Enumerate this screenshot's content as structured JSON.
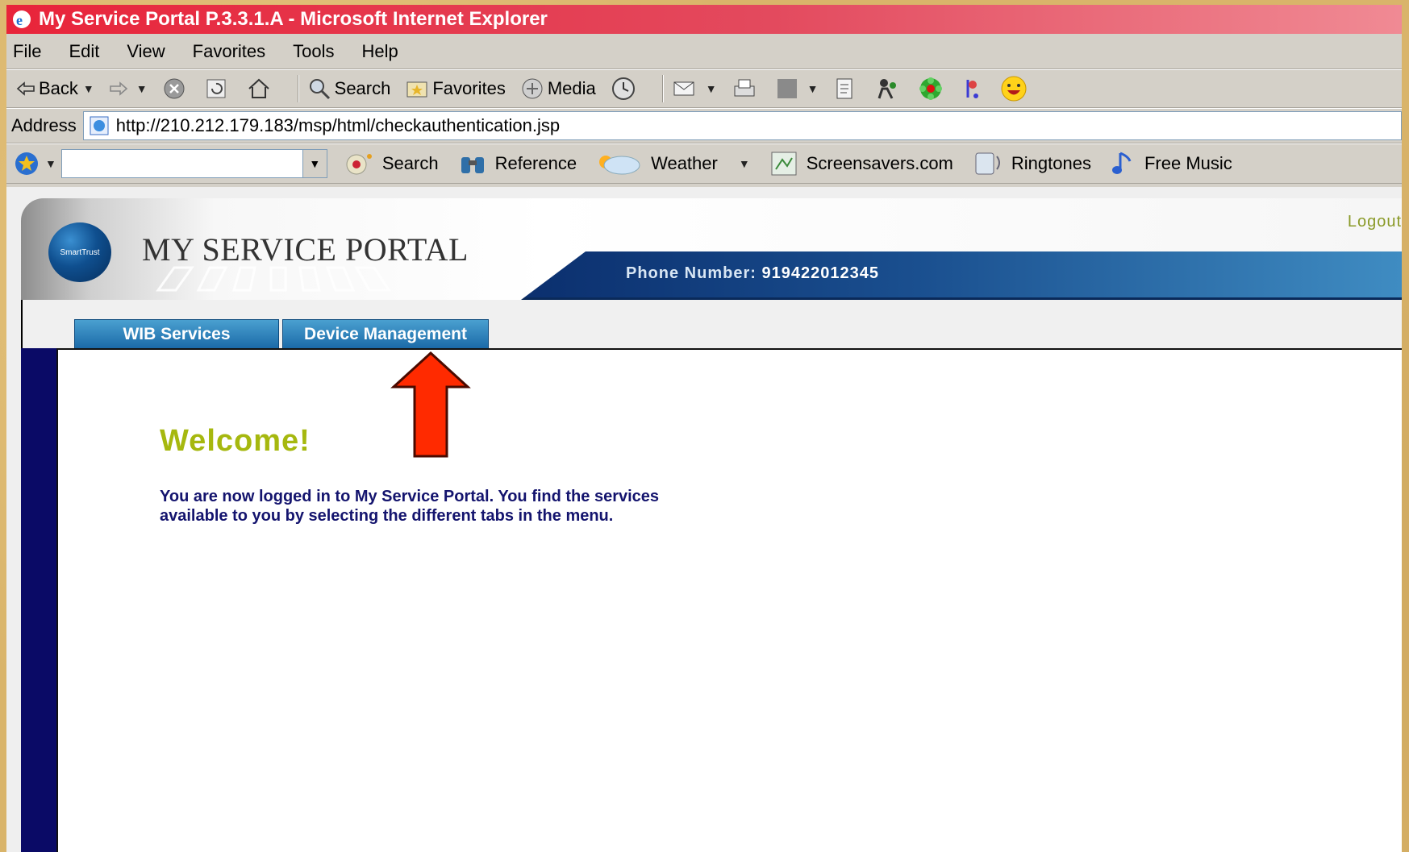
{
  "window": {
    "title": "My Service Portal P.3.3.1.A - Microsoft Internet Explorer"
  },
  "menubar": {
    "items": [
      "File",
      "Edit",
      "View",
      "Favorites",
      "Tools",
      "Help"
    ]
  },
  "toolbar": {
    "back_label": "Back",
    "search_label": "Search",
    "favorites_label": "Favorites",
    "media_label": "Media"
  },
  "addressbar": {
    "label": "Address",
    "url": "http://210.212.179.183/msp/html/checkauthentication.jsp"
  },
  "linksbar": {
    "search_label": "Search",
    "reference_label": "Reference",
    "weather_label": "Weather",
    "screensavers_label": "Screensavers.com",
    "ringtones_label": "Ringtones",
    "music_label": "Free Music"
  },
  "portal": {
    "title": "MY SERVICE PORTAL",
    "logo_text": "SmartTrust",
    "logout_label": "Logout",
    "phone_label": "Phone Number:",
    "phone_number": "919422012345",
    "tabs": [
      {
        "label": "WIB Services"
      },
      {
        "label": "Device Management"
      }
    ],
    "welcome_heading": "Welcome!",
    "welcome_line1": "You are now logged in to My Service Portal. You find the services",
    "welcome_line2": "available to you by selecting the different tabs in the menu."
  },
  "colors": {
    "title_bar": "#e8243a",
    "tab_blue": "#1b6aa8",
    "welcome_green": "#a6b80f",
    "nav_navy": "#0a0a66",
    "annotation_arrow": "#ff2a00"
  }
}
